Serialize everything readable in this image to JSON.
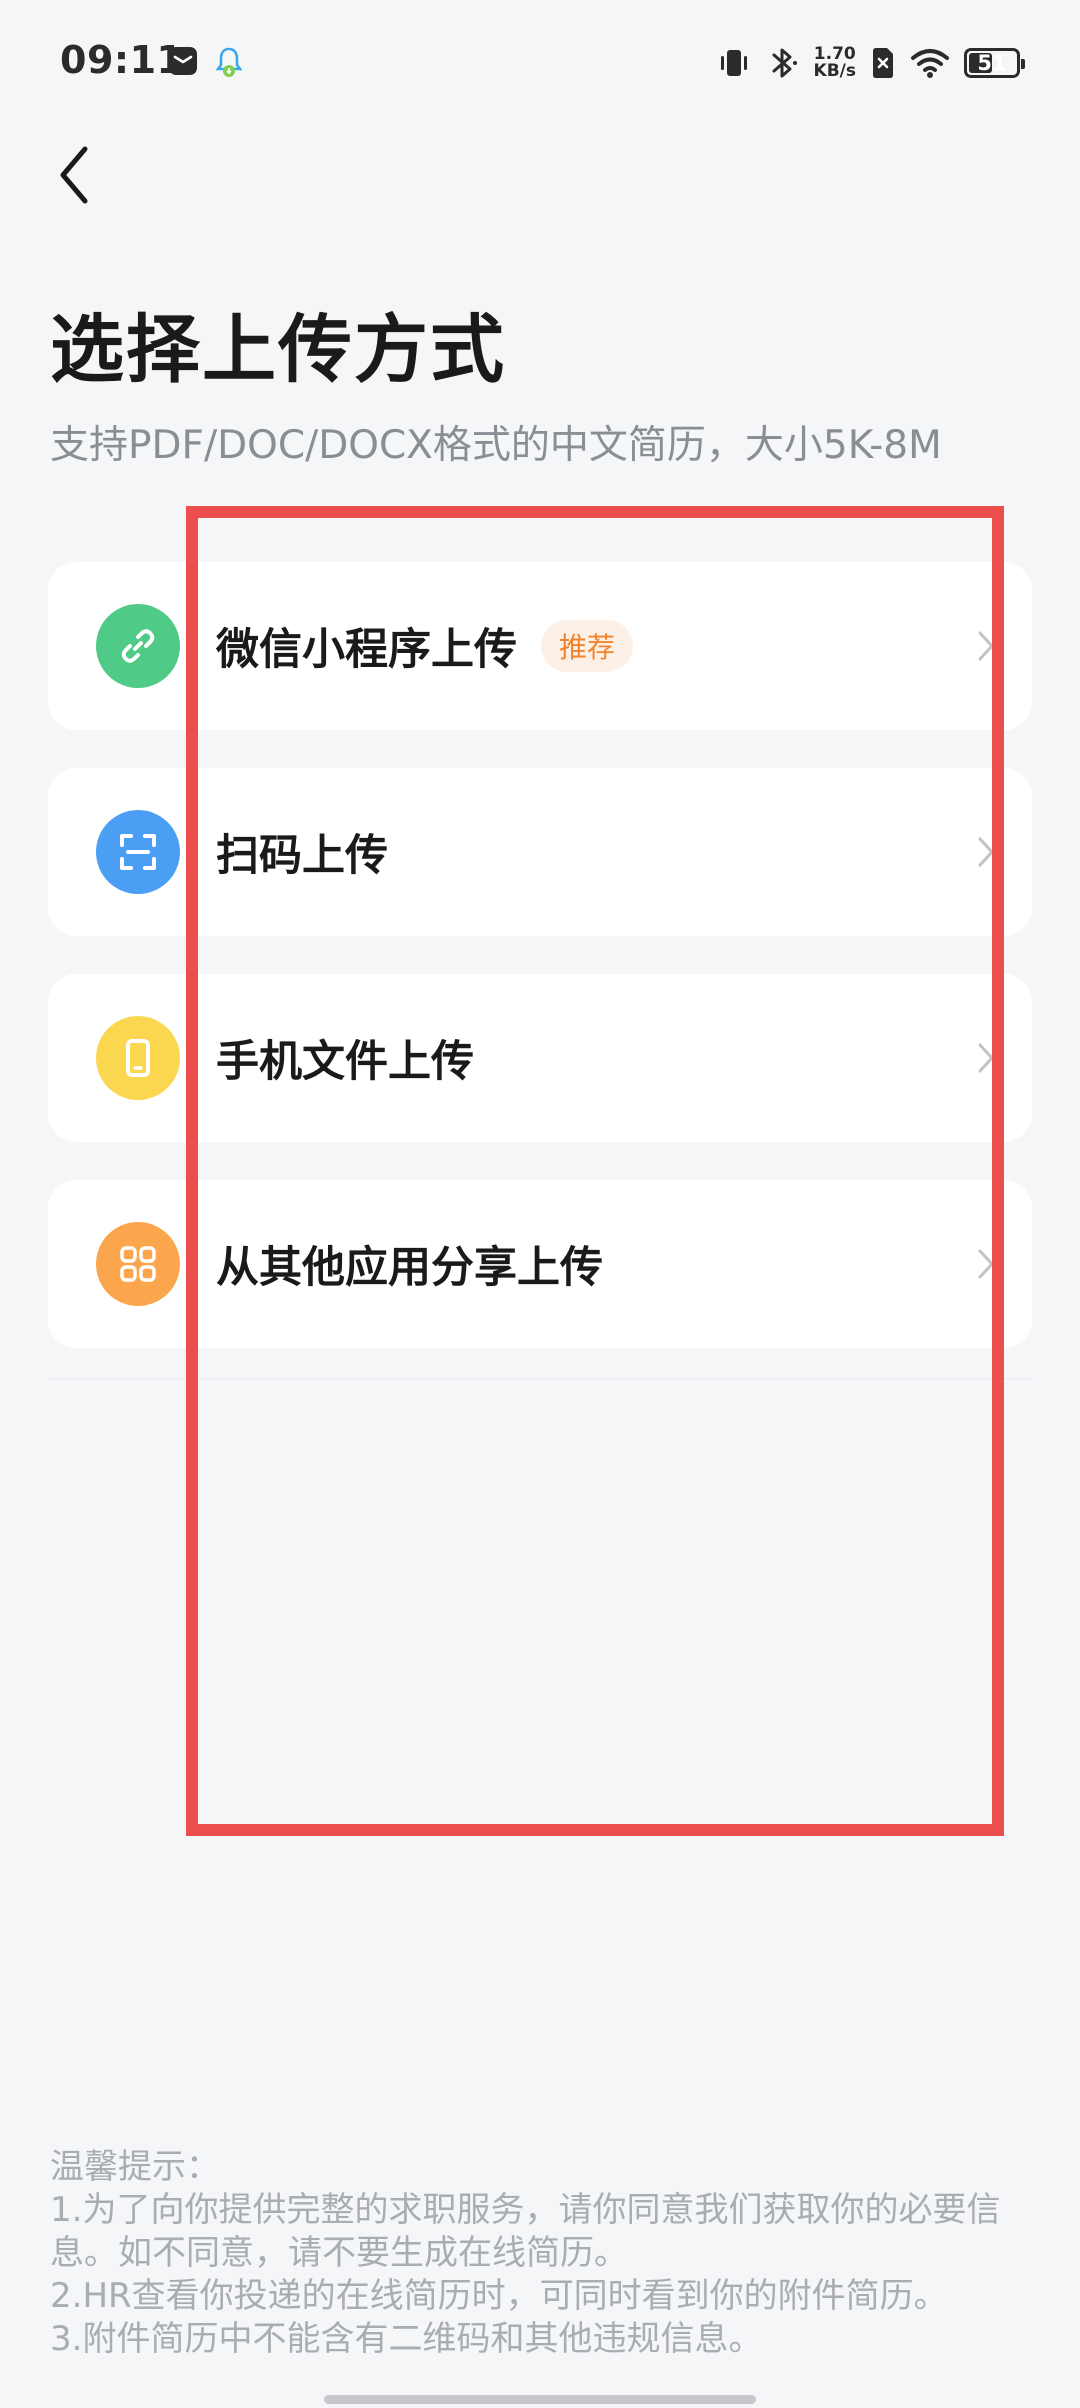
{
  "status_bar": {
    "time": "09:11",
    "net_speed_value": "1.70",
    "net_speed_unit": "KB/s",
    "battery": "51",
    "battery_level_percent": 51
  },
  "header": {
    "title": "选择上传方式",
    "subtitle": "支持PDF/DOC/DOCX格式的中文简历，大小5K-8M"
  },
  "options": [
    {
      "label": "微信小程序上传",
      "badge": "推荐",
      "icon": "link-icon",
      "color": "#4fcb87"
    },
    {
      "label": "扫码上传",
      "icon": "scan-icon",
      "color": "#4a9ff5"
    },
    {
      "label": "手机文件上传",
      "icon": "phone-icon",
      "color": "#fbd64f"
    },
    {
      "label": "从其他应用分享上传",
      "icon": "apps-icon",
      "color": "#fba64c"
    }
  ],
  "tips": {
    "heading": "温馨提示：",
    "lines": [
      "1.为了向你提供完整的求职服务，请你同意我们获取你的必要信息。如不同意，请不要生成在线简历。",
      "2.HR查看你投递的在线简历时，可同时看到你的附件简历。",
      "3.附件简历中不能含有二维码和其他违规信息。"
    ]
  },
  "colors": {
    "background": "#f5f6f8",
    "highlight": "#ec4d4d",
    "badge_text": "#f0852d",
    "badge_bg": "#fdf0e6"
  }
}
